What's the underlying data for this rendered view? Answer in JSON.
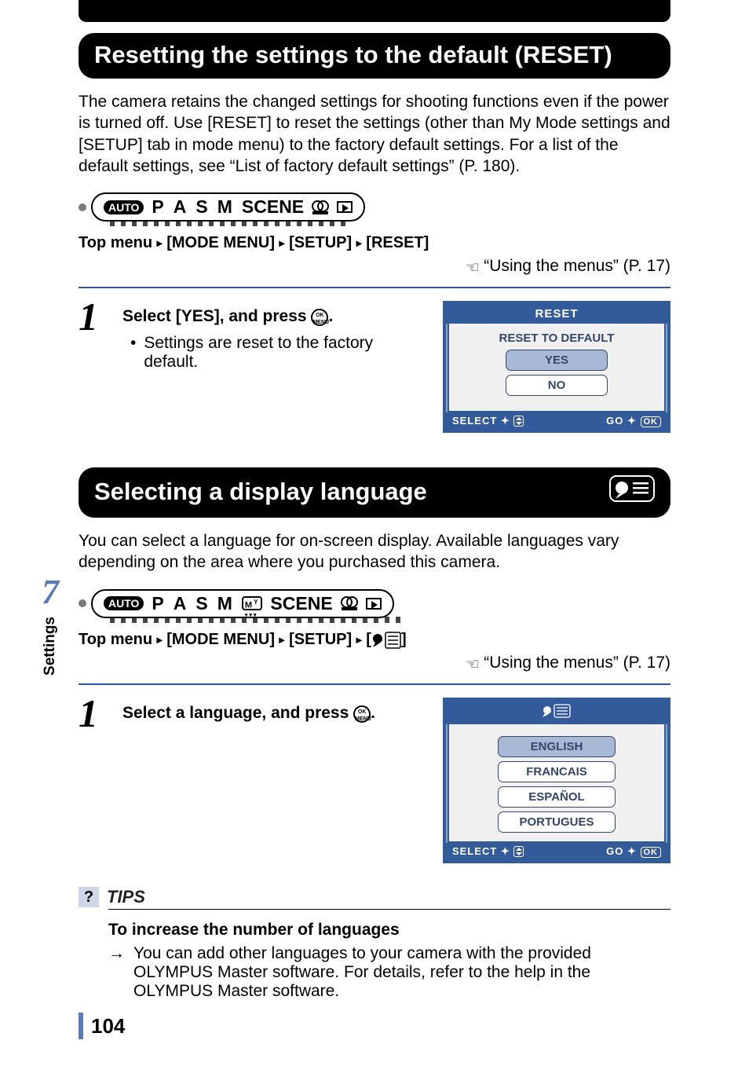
{
  "top_black": "",
  "side_tab": {
    "number": "7",
    "label": "Settings"
  },
  "page_number": "104",
  "section1": {
    "heading": "Resetting the settings to the default (RESET)",
    "intro": "The camera retains the changed settings for shooting functions even if the power is turned off. Use [RESET] to reset the settings (other than My Mode settings and [SETUP] tab in mode menu) to the factory default settings. For a list of the default settings, see “List of factory default settings” (P. 180).",
    "modes": {
      "auto": "AUTO",
      "p": "P",
      "a": "A",
      "s": "S",
      "m": "M",
      "scene": "SCENE"
    },
    "path": {
      "top_menu": "Top menu",
      "p1": "[MODE MENU]",
      "p2": "[SETUP]",
      "p3": "[RESET]",
      "arrow": "▸"
    },
    "ref": "“Using the menus” (P. 17)",
    "step_num": "1",
    "step_title_a": "Select [YES], and press ",
    "step_title_b": ".",
    "ok_menu": "OK\nMENU",
    "bullet": "Settings are reset to the factory default.",
    "screen": {
      "title": "RESET",
      "subtitle": "RESET TO DEFAULT",
      "yes": "YES",
      "no": "NO",
      "select": "SELECT",
      "go": "GO",
      "ok": "OK"
    }
  },
  "section2": {
    "heading": "Selecting a display language",
    "intro": "You can select a language for on-screen display. Available languages vary depending on the area where you purchased this camera.",
    "modes": {
      "auto": "AUTO",
      "p": "P",
      "a": "A",
      "s": "S",
      "m": "M",
      "my": "Mᵧ",
      "scene": "SCENE"
    },
    "path": {
      "top_menu": "Top menu",
      "p1": "[MODE MENU]",
      "p2": "[SETUP]",
      "p3a": "[",
      "p3b": "]",
      "arrow": "▸"
    },
    "ref": "“Using the menus” (P. 17)",
    "step_num": "1",
    "step_title_a": "Select a language, and press ",
    "step_title_b": ".",
    "ok_menu": "OK\nMENU",
    "screen": {
      "opts": [
        "ENGLISH",
        "FRANCAIS",
        "ESPAÑOL",
        "PORTUGUES"
      ],
      "select": "SELECT",
      "go": "GO",
      "ok": "OK"
    }
  },
  "tips": {
    "label": "TIPS",
    "q": "?",
    "bold": "To increase the number of languages",
    "arrow": "→",
    "body": "You can add other languages to your camera with the provided OLYMPUS Master software. For details, refer to the help in the OLYMPUS Master software."
  }
}
